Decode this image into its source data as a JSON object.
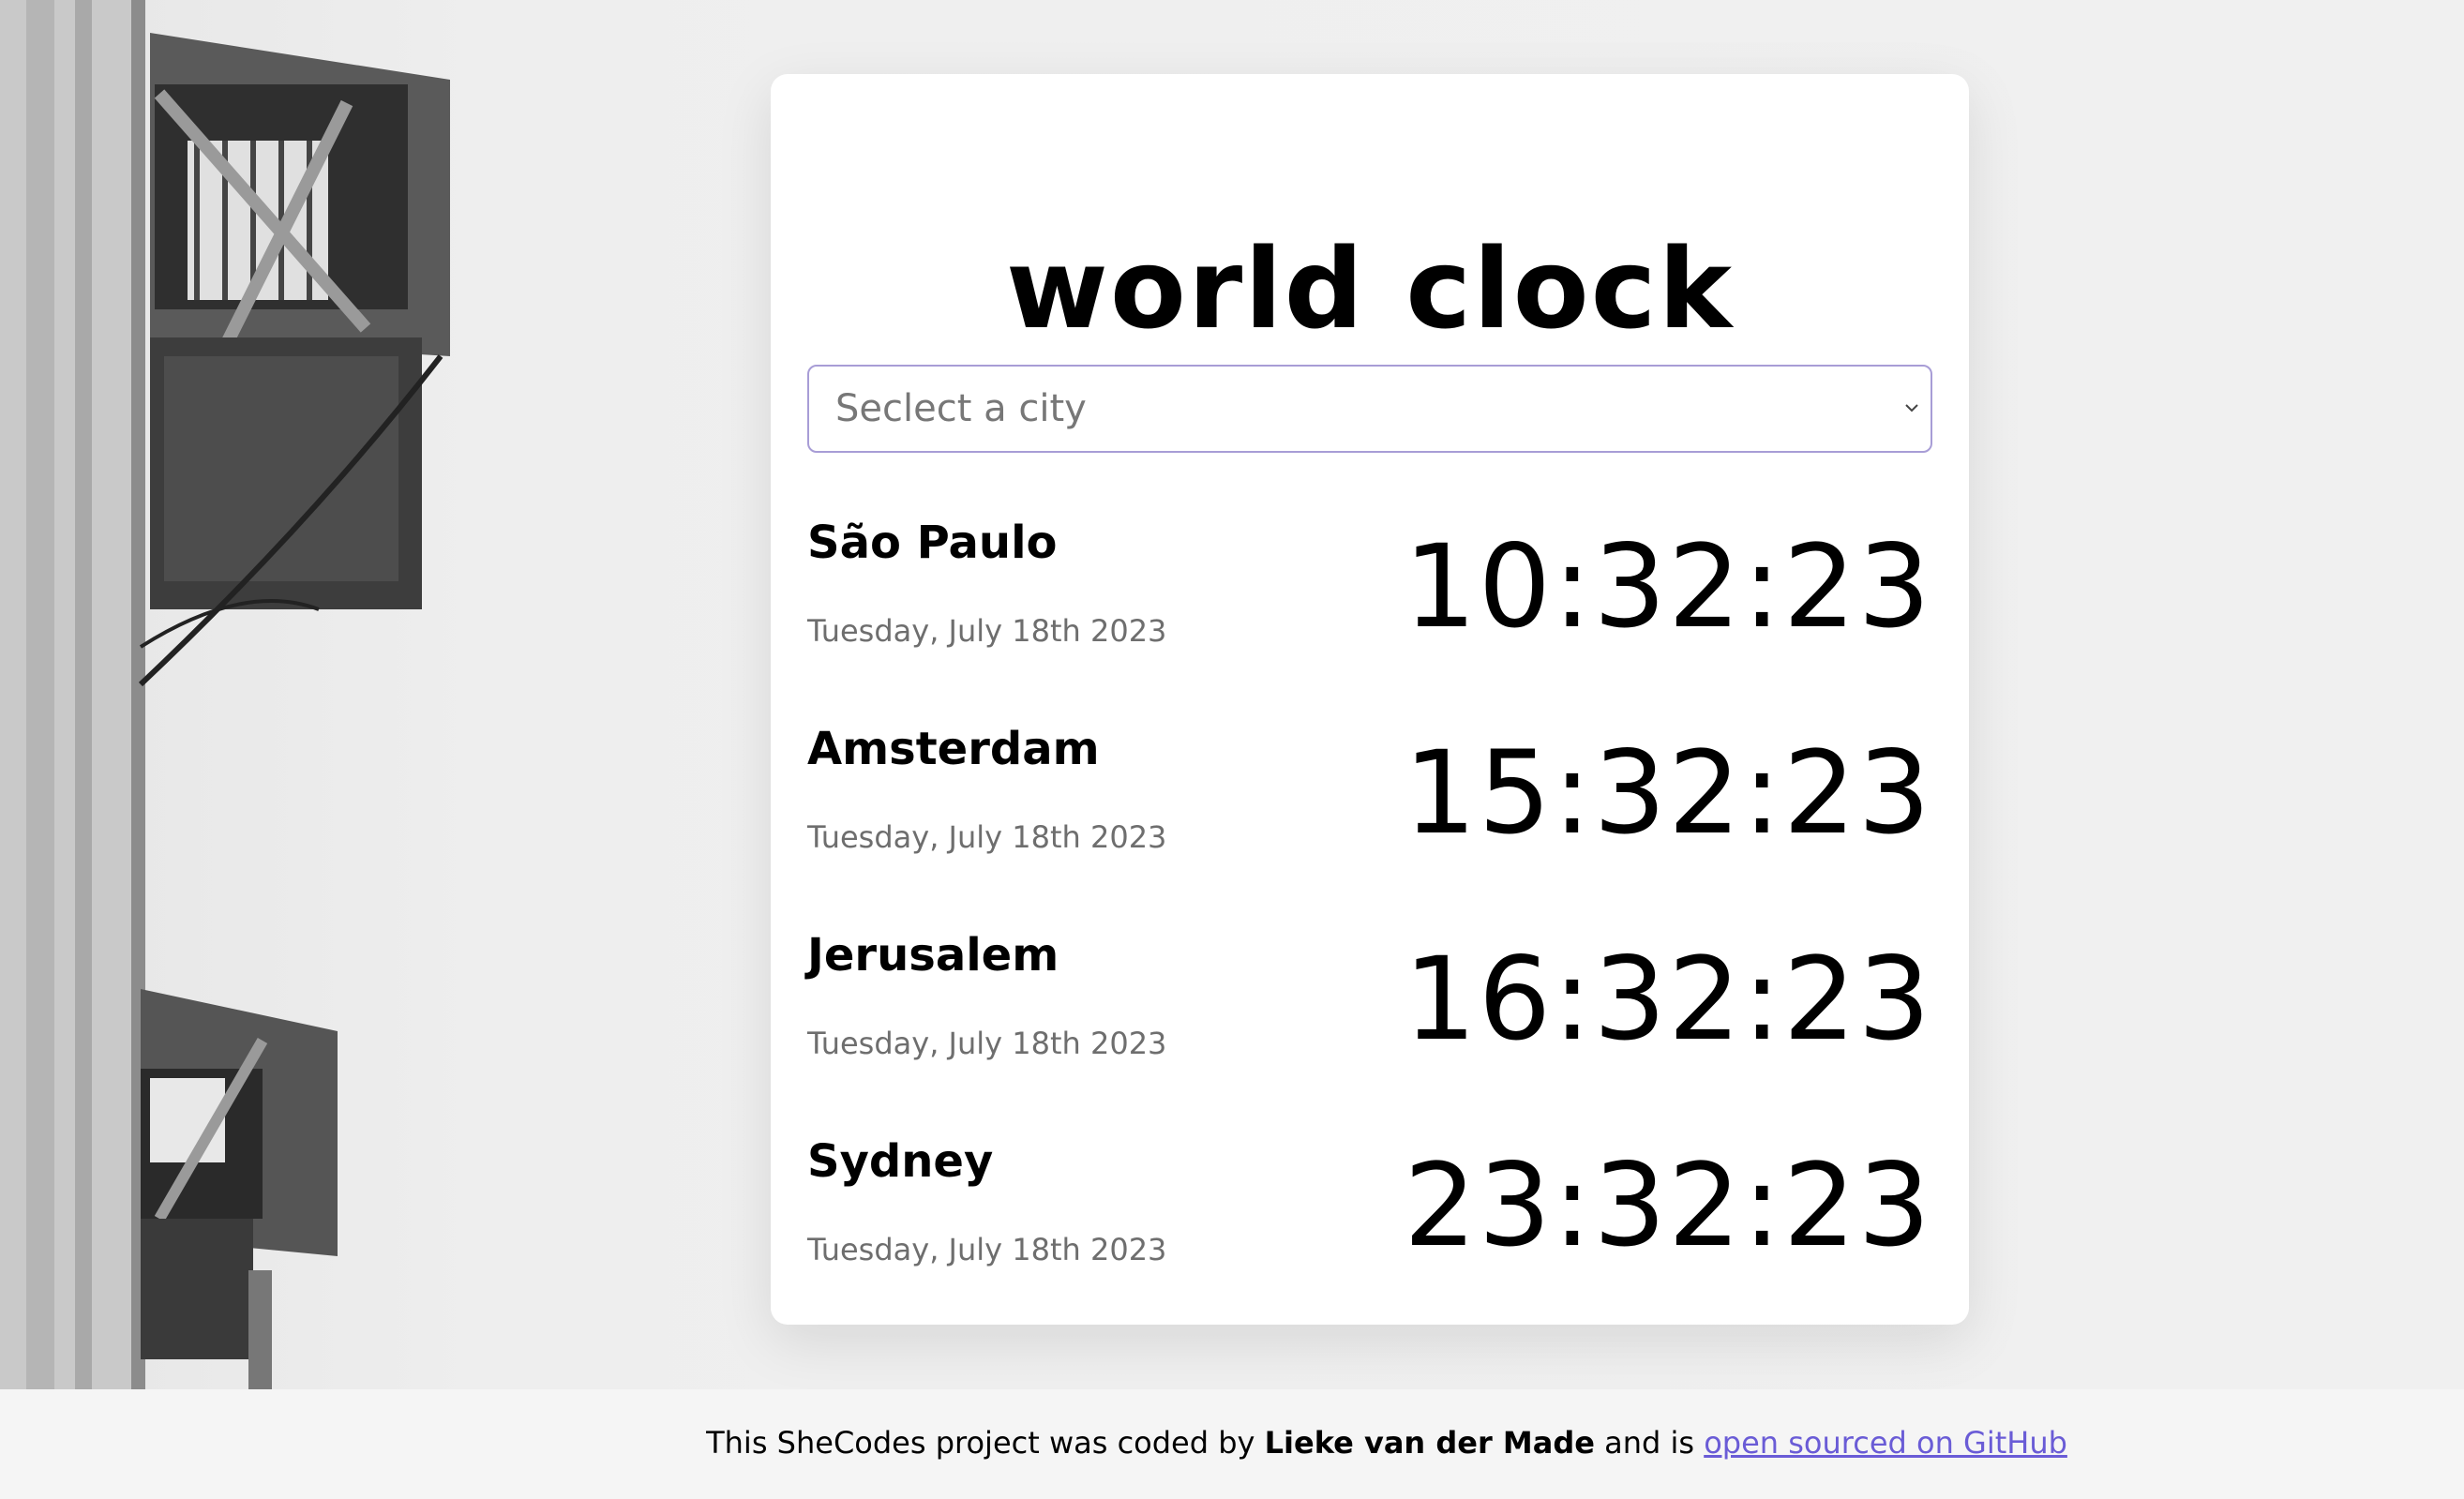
{
  "app": {
    "title": "world clock"
  },
  "select": {
    "placeholder": "Seclect a city"
  },
  "cities": [
    {
      "name": "São Paulo",
      "date": "Tuesday, July 18th 2023",
      "time": "10:32:23"
    },
    {
      "name": "Amsterdam",
      "date": "Tuesday, July 18th 2023",
      "time": "15:32:23"
    },
    {
      "name": "Jerusalem",
      "date": "Tuesday, July 18th 2023",
      "time": "16:32:23"
    },
    {
      "name": "Sydney",
      "date": "Tuesday, July 18th 2023",
      "time": "23:32:23"
    }
  ],
  "footer": {
    "prefix": "This SheCodes project was coded by",
    "author": "Lieke van der Made",
    "middle": "and is",
    "link_label": "open sourced on GitHub"
  },
  "colors": {
    "accent": "#6a5cd6",
    "select_border": "#a89dd6",
    "card_bg": "#ffffff",
    "page_bg": "#efefef"
  },
  "icons": {
    "select_arrow": "chevron-down-icon"
  }
}
